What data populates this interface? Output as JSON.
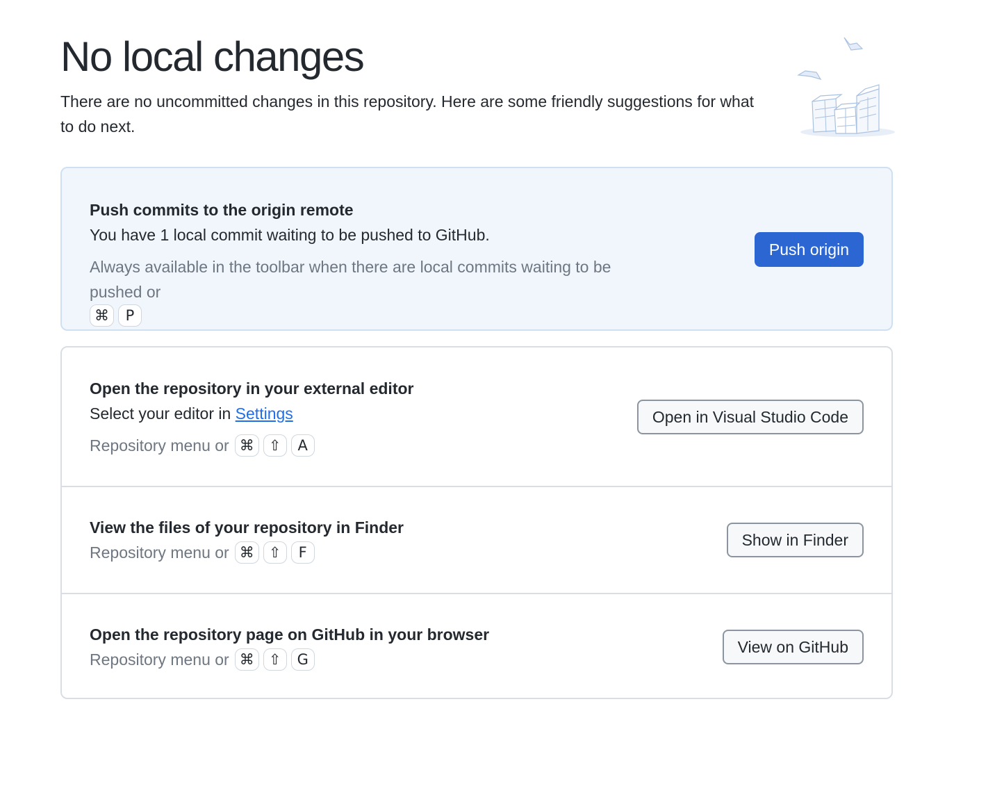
{
  "header": {
    "title": "No local changes",
    "subtitle": "There are no uncommitted changes in this repository. Here are some friendly suggestions for what to do next."
  },
  "push": {
    "title": "Push commits to the origin remote",
    "description": "You have 1 local commit waiting to be pushed to GitHub.",
    "hint": "Always available in the toolbar when there are local commits waiting to be pushed or",
    "shortcut": [
      "⌘",
      "P"
    ],
    "button": "Push origin"
  },
  "editor": {
    "title": "Open the repository in your external editor",
    "description_prefix": "Select your editor in",
    "settings_link": "Settings",
    "hint": "Repository menu or",
    "shortcut": [
      "⌘",
      "⇧",
      "A"
    ],
    "button": "Open in Visual Studio Code"
  },
  "finder": {
    "title": "View the files of your repository in Finder",
    "hint": "Repository menu or",
    "shortcut": [
      "⌘",
      "⇧",
      "F"
    ],
    "button": "Show in Finder"
  },
  "github": {
    "title": "Open the repository page on GitHub in your browser",
    "hint": "Repository menu or",
    "shortcut": [
      "⌘",
      "⇧",
      "G"
    ],
    "button": "View on GitHub"
  },
  "colors": {
    "primary_button": "#2b66d3",
    "push_card_bg": "#f1f6fd",
    "link": "#1f6feb",
    "hint_text": "#6e7781"
  },
  "icons": {
    "illustration": "empty-boxes-illustration",
    "command_key": "command-key-icon",
    "shift_key": "shift-key-icon"
  }
}
